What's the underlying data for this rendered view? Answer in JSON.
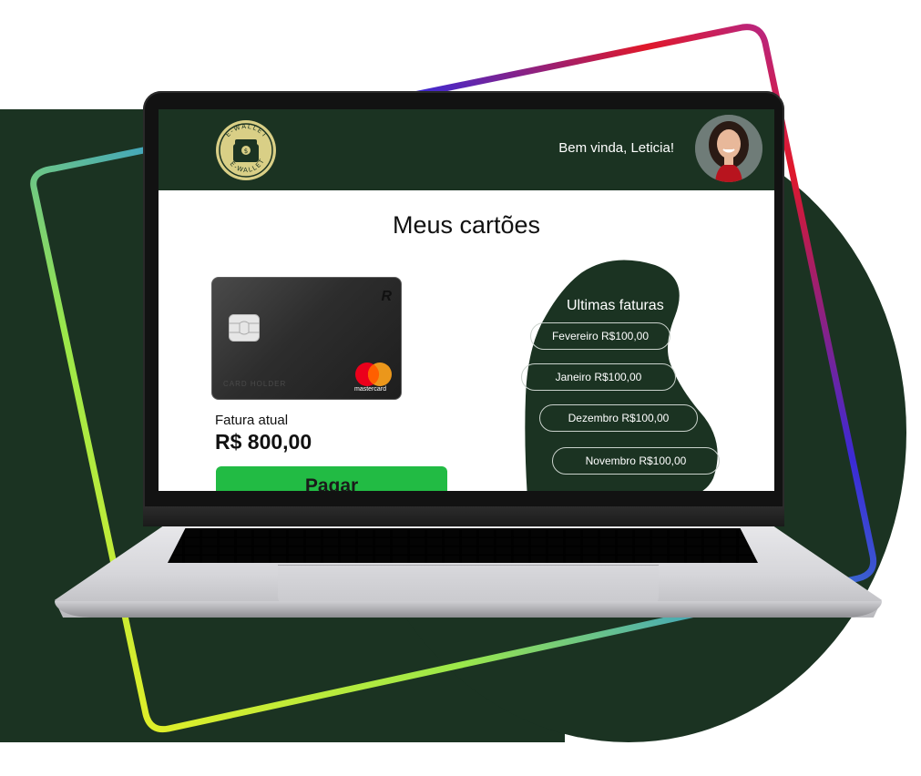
{
  "header": {
    "logo_text": "E-WALLET",
    "welcome": "Bem vinda, Leticia!"
  },
  "main": {
    "title": "Meus cartões",
    "card": {
      "holder": "CARD HOLDER",
      "brand_mark": "R",
      "network": "mastercard"
    },
    "current_invoice_label": "Fatura atual",
    "current_invoice_amount": "R$ 800,00",
    "pay_button": "Pagar"
  },
  "invoices": {
    "title": "Ultimas faturas",
    "items": [
      {
        "label": "Fevereiro R$100,00"
      },
      {
        "label": "Janeiro R$100,00"
      },
      {
        "label": "Dezembro R$100,00"
      },
      {
        "label": "Novembro R$100,00"
      }
    ]
  },
  "colors": {
    "brand_dark_green": "#1b3322",
    "pay_button_green": "#22bb44",
    "logo_gold": "#d9cf86"
  },
  "icons": [
    "wallet-logo-icon",
    "card-chip-icon",
    "mastercard-logo-icon",
    "user-avatar"
  ]
}
